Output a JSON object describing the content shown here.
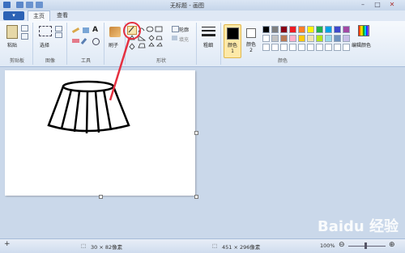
{
  "titlebar": {
    "title": "无标题 - 画图"
  },
  "app_menu": {
    "label": ""
  },
  "tabs": [
    {
      "label": "主页"
    },
    {
      "label": "查看"
    }
  ],
  "clipboard": {
    "paste_label": "粘贴",
    "group_label": "剪贴板"
  },
  "image": {
    "select_label": "选择",
    "group_label": "图像"
  },
  "tools": {
    "group_label": "工具"
  },
  "brushes": {
    "label": "刷子"
  },
  "shapes": {
    "outline_label": "轮廓",
    "fill_label": "填充",
    "group_label": "形状"
  },
  "size": {
    "label": "粗细"
  },
  "colors": {
    "color1_label": "颜色 1",
    "color2_label": "颜色 2",
    "edit_label": "编辑颜色",
    "group_label": "颜色",
    "color1": "#000000",
    "color2": "#ffffff",
    "palette_row1": [
      "#000000",
      "#7f7f7f",
      "#880015",
      "#ed1c24",
      "#ff7f27",
      "#fff200",
      "#22b14c",
      "#00a2e8",
      "#3f48cc",
      "#a349a4"
    ],
    "palette_row2": [
      "#ffffff",
      "#c3c3c3",
      "#b97a57",
      "#ffaec9",
      "#ffc90e",
      "#efe4b0",
      "#b5e61d",
      "#99d9ea",
      "#7092be",
      "#c8bfe7"
    ]
  },
  "status": {
    "selection_size": "30 × 82像素",
    "canvas_size": "451 × 296像素",
    "zoom": "100%"
  },
  "watermark": "Baidu 经验"
}
